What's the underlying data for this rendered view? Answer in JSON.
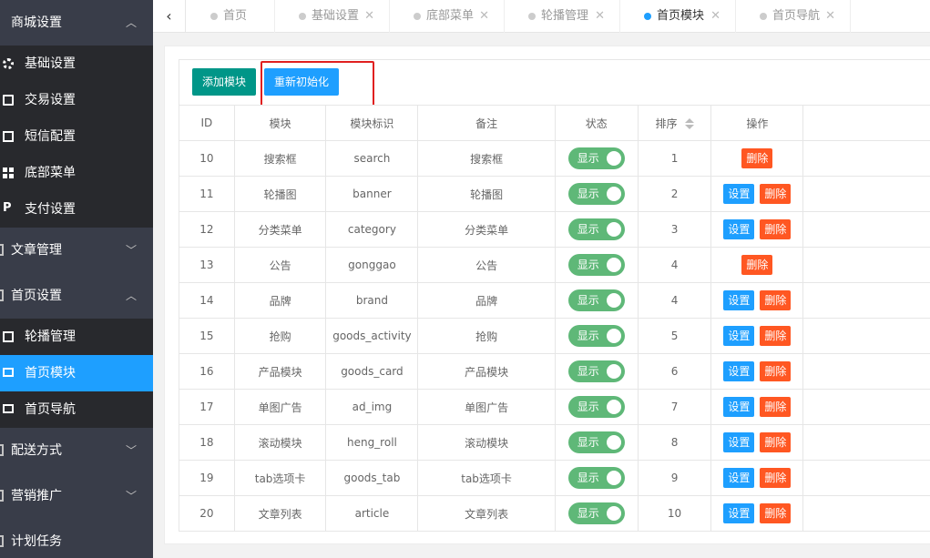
{
  "sidebar": {
    "groups": [
      {
        "label": "商城设置",
        "expanded": true,
        "items": [
          {
            "label": "基础设置",
            "icon": "gear-icon"
          },
          {
            "label": "交易设置",
            "icon": "card-icon"
          },
          {
            "label": "短信配置",
            "icon": "mail-icon"
          },
          {
            "label": "底部菜单",
            "icon": "grid-icon"
          },
          {
            "label": "支付设置",
            "icon": "paypal-icon"
          }
        ]
      },
      {
        "label": "文章管理",
        "expanded": false
      },
      {
        "label": "首页设置",
        "expanded": true,
        "items": [
          {
            "label": "轮播管理",
            "icon": "image-icon"
          },
          {
            "label": "首页模块",
            "icon": "monitor-icon",
            "active": true
          },
          {
            "label": "首页导航",
            "icon": "monitor-icon"
          }
        ]
      },
      {
        "label": "配送方式",
        "expanded": false
      },
      {
        "label": "营销推广",
        "expanded": false
      },
      {
        "label": "计划任务",
        "expanded": false
      }
    ]
  },
  "tabs": [
    {
      "label": "首页",
      "closable": false
    },
    {
      "label": "基础设置",
      "closable": true
    },
    {
      "label": "底部菜单",
      "closable": true
    },
    {
      "label": "轮播管理",
      "closable": true
    },
    {
      "label": "首页模块",
      "closable": true,
      "active": true
    },
    {
      "label": "首页导航",
      "closable": true
    }
  ],
  "toolbar": {
    "add_label": "添加模块",
    "reinit_label": "重新初始化"
  },
  "table": {
    "headers": [
      "ID",
      "模块",
      "模块标识",
      "备注",
      "状态",
      "排序",
      "操作"
    ],
    "status_label": "显示",
    "set_label": "设置",
    "delete_label": "删除",
    "rows": [
      {
        "id": "10",
        "module": "搜索框",
        "key": "search",
        "note": "搜索框",
        "sort": "1",
        "settable": false
      },
      {
        "id": "11",
        "module": "轮播图",
        "key": "banner",
        "note": "轮播图",
        "sort": "2",
        "settable": true
      },
      {
        "id": "12",
        "module": "分类菜单",
        "key": "category",
        "note": "分类菜单",
        "sort": "3",
        "settable": true
      },
      {
        "id": "13",
        "module": "公告",
        "key": "gonggao",
        "note": "公告",
        "sort": "4",
        "settable": false
      },
      {
        "id": "14",
        "module": "品牌",
        "key": "brand",
        "note": "品牌",
        "sort": "4",
        "settable": true
      },
      {
        "id": "15",
        "module": "抢购",
        "key": "goods_activity",
        "note": "抢购",
        "sort": "5",
        "settable": true
      },
      {
        "id": "16",
        "module": "产品模块",
        "key": "goods_card",
        "note": "产品模块",
        "sort": "6",
        "settable": true
      },
      {
        "id": "17",
        "module": "单图广告",
        "key": "ad_img",
        "note": "单图广告",
        "sort": "7",
        "settable": true
      },
      {
        "id": "18",
        "module": "滚动模块",
        "key": "heng_roll",
        "note": "滚动模块",
        "sort": "8",
        "settable": true
      },
      {
        "id": "19",
        "module": "tab选项卡",
        "key": "goods_tab",
        "note": "tab选项卡",
        "sort": "9",
        "settable": true
      },
      {
        "id": "20",
        "module": "文章列表",
        "key": "article",
        "note": "文章列表",
        "sort": "10",
        "settable": true
      }
    ]
  },
  "colors": {
    "sidebar_bg": "#393d49",
    "sidebar_sub_bg": "#28292d",
    "accent": "#1e9fff",
    "add_button": "#009688",
    "switch_on": "#5fb878",
    "delete": "#ff5722",
    "highlight_box": "#e02020"
  }
}
